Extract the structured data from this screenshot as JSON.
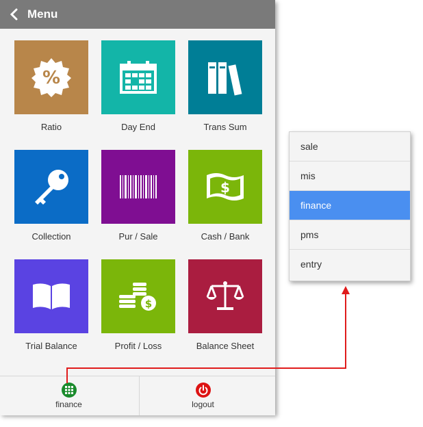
{
  "header": {
    "title": "Menu",
    "back_icon": "chevron-left-icon"
  },
  "tiles": [
    {
      "label": "Ratio",
      "color": "#b8864a",
      "icon": "percent-badge-icon"
    },
    {
      "label": "Day End",
      "color": "#13b5a8",
      "icon": "calendar-icon"
    },
    {
      "label": "Trans Sum",
      "color": "#007e96",
      "icon": "books-icon"
    },
    {
      "label": "Collection",
      "color": "#0b6cc6",
      "icon": "key-icon"
    },
    {
      "label": "Pur / Sale",
      "color": "#7f0e92",
      "icon": "barcode-icon"
    },
    {
      "label": "Cash / Bank",
      "color": "#7bb60a",
      "icon": "money-icon"
    },
    {
      "label": "Trial Balance",
      "color": "#5a43e2",
      "icon": "open-book-icon"
    },
    {
      "label": "Profit / Loss",
      "color": "#7bb60a",
      "icon": "coins-icon"
    },
    {
      "label": "Balance Sheet",
      "color": "#aa1d40",
      "icon": "scale-icon"
    }
  ],
  "bottom_bar": {
    "tabs": [
      {
        "label": "finance",
        "icon": "grid-icon",
        "color": "#1a8b2c"
      },
      {
        "label": "logout",
        "icon": "power-icon",
        "color": "#dd1313"
      }
    ]
  },
  "dropdown": {
    "items": [
      "sale",
      "mis",
      "finance",
      "pms",
      "entry"
    ],
    "active": "finance",
    "active_color": "#4a8ff0"
  },
  "connector_color": "#e01b1b"
}
